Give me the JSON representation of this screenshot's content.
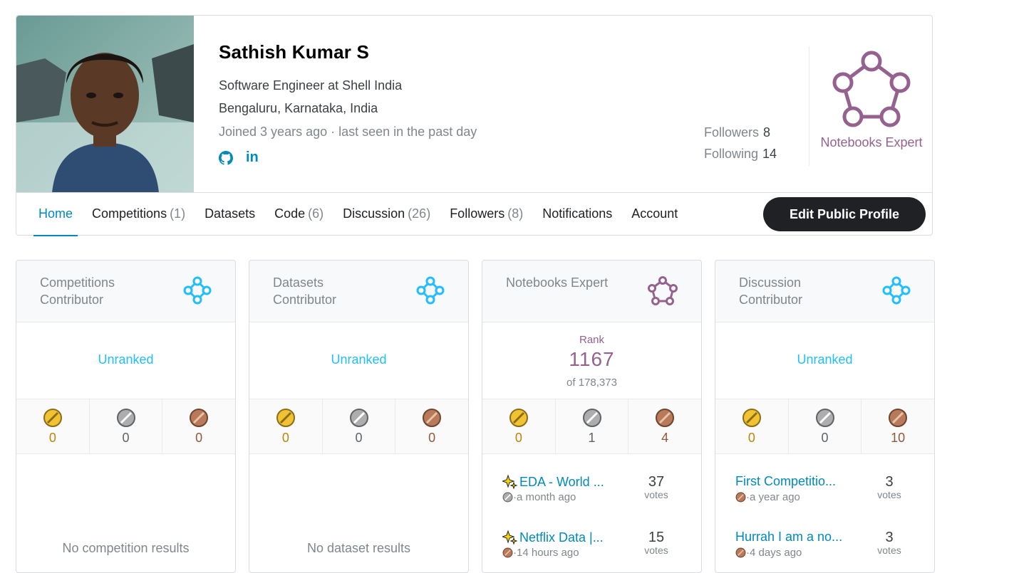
{
  "profile": {
    "name": "Sathish Kumar S",
    "occupation": "Software Engineer at Shell India",
    "location": "Bengaluru, Karnataka, India",
    "joined": "Joined 3 years ago · last seen in the past day",
    "followers_label": "Followers",
    "followers_value": "8",
    "following_label": "Following",
    "following_value": "14",
    "tier_label": "Notebooks Expert",
    "linkedin_text": "in"
  },
  "nav": {
    "tabs": [
      {
        "label": "Home",
        "count": ""
      },
      {
        "label": "Competitions",
        "count": "(1)"
      },
      {
        "label": "Datasets",
        "count": ""
      },
      {
        "label": "Code",
        "count": "(6)"
      },
      {
        "label": "Discussion",
        "count": "(26)"
      },
      {
        "label": "Followers",
        "count": "(8)"
      },
      {
        "label": "Notifications",
        "count": ""
      },
      {
        "label": "Account",
        "count": ""
      }
    ],
    "edit_button": "Edit Public Profile"
  },
  "cards": [
    {
      "title": "Competitions Contributor",
      "unranked": "Unranked",
      "gold": "0",
      "silver": "0",
      "bronze": "0",
      "empty": "No competition results"
    },
    {
      "title": "Datasets Contributor",
      "unranked": "Unranked",
      "gold": "0",
      "silver": "0",
      "bronze": "0",
      "empty": "No dataset results"
    },
    {
      "title": "Notebooks Expert",
      "rank_label": "Rank",
      "rank_value": "1167",
      "rank_of": "of 178,373",
      "gold": "0",
      "silver": "1",
      "bronze": "4",
      "items": [
        {
          "title": "EDA - World ...",
          "meta": "·a month ago",
          "votes": "37",
          "votes_label": "votes"
        },
        {
          "title": "Netflix Data |...",
          "meta": "·14 hours ago",
          "votes": "15",
          "votes_label": "votes"
        }
      ]
    },
    {
      "title": "Discussion Contributor",
      "unranked": "Unranked",
      "gold": "0",
      "silver": "0",
      "bronze": "10",
      "items": [
        {
          "title": "First Competitio...",
          "meta": "·a year ago",
          "votes": "3",
          "votes_label": "votes"
        },
        {
          "title": "Hurrah I am a no...",
          "meta": "·4 days ago",
          "votes": "3",
          "votes_label": "votes"
        }
      ]
    }
  ],
  "colors": {
    "accent": "#008abc",
    "contributor": "#20beff",
    "expert": "#95628f",
    "gold": "#f1c232",
    "silver": "#adadad",
    "bronze": "#b87a5a"
  }
}
